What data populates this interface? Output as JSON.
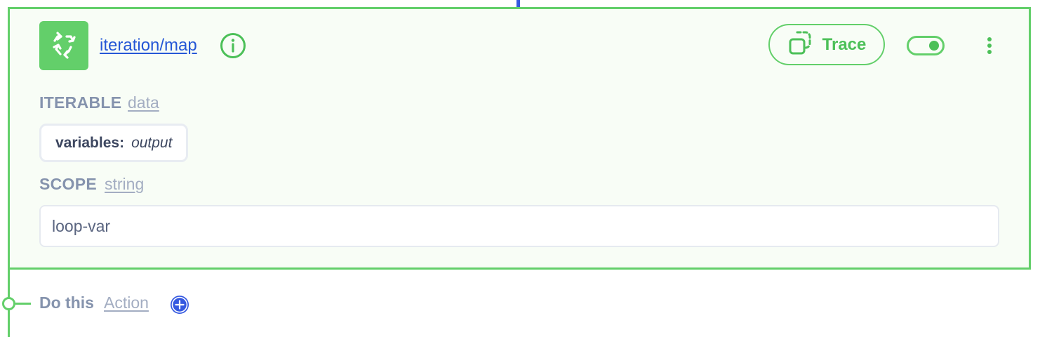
{
  "node": {
    "title": "iteration/map",
    "icon": "recycle-icon",
    "accent_color": "#63cf6a",
    "link_color": "#2557d6"
  },
  "toolbar": {
    "trace_label": "Trace",
    "trace_icon": "copy-dashed-icon",
    "toggle_state": "on",
    "more_icon": "more-vertical-icon"
  },
  "fields": {
    "iterable": {
      "label": "ITERABLE",
      "type": "data",
      "chip_key": "variables:",
      "chip_value": "output"
    },
    "scope": {
      "label": "SCOPE",
      "type": "string",
      "value": "loop-var"
    }
  },
  "next_step": {
    "label": "Do this",
    "type": "Action",
    "add_icon": "plus-circle-icon",
    "add_color": "#3559e0"
  }
}
